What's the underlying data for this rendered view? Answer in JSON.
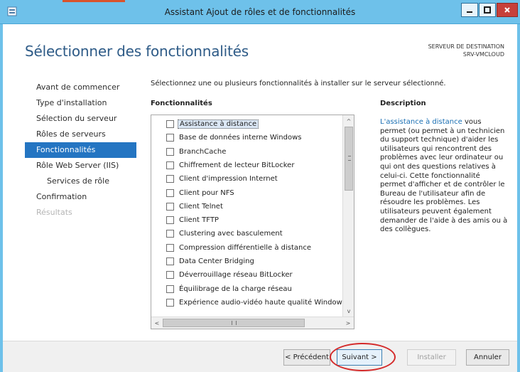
{
  "window": {
    "title": "Assistant Ajout de rôles et de fonctionnalités",
    "min_symbol": "–",
    "max_symbol": "□",
    "close_symbol": "x"
  },
  "header": {
    "page_title": "Sélectionner des fonctionnalités",
    "dest_label": "SERVEUR DE DESTINATION",
    "dest_server": "SRV-VMCLOUD"
  },
  "nav": {
    "items": [
      {
        "label": "Avant de commencer",
        "state": "normal"
      },
      {
        "label": "Type d'installation",
        "state": "normal"
      },
      {
        "label": "Sélection du serveur",
        "state": "normal"
      },
      {
        "label": "Rôles de serveurs",
        "state": "normal"
      },
      {
        "label": "Fonctionnalités",
        "state": "active"
      },
      {
        "label": "Rôle Web Server (IIS)",
        "state": "normal"
      },
      {
        "label": "Services de rôle",
        "state": "sub"
      },
      {
        "label": "Confirmation",
        "state": "normal"
      },
      {
        "label": "Résultats",
        "state": "disabled"
      }
    ]
  },
  "main": {
    "instruction": "Sélectionnez une ou plusieurs fonctionnalités à installer sur le serveur sélectionné.",
    "features_header": "Fonctionnalités",
    "description_header": "Description",
    "features": [
      "Assistance à distance",
      "Base de données interne Windows",
      "BranchCache",
      "Chiffrement de lecteur BitLocker",
      "Client d'impression Internet",
      "Client pour NFS",
      "Client Telnet",
      "Client TFTP",
      "Clustering avec basculement",
      "Compression différentielle à distance",
      "Data Center Bridging",
      "Déverrouillage réseau BitLocker",
      "Équilibrage de la charge réseau",
      "Expérience audio-vidéo haute qualité Windows"
    ],
    "selected_index": 0,
    "scroll_up": "^",
    "scroll_down": "v",
    "scroll_left": "<",
    "scroll_right": ">",
    "description_link": "L'assistance à distance",
    "description_text": " vous permet (ou permet à un technicien du support technique) d'aider les utilisateurs qui rencontrent des problèmes avec leur ordinateur ou qui ont des questions relatives à celui-ci. Cette fonctionnalité permet d'afficher et de contrôler le Bureau de l'utilisateur afin de résoudre les problèmes. Les utilisateurs peuvent également demander de l'aide à des amis ou à des collègues."
  },
  "footer": {
    "prev_label": "< Précédent",
    "next_label": "Suivant >",
    "install_label": "Installer",
    "cancel_label": "Annuler"
  },
  "colors": {
    "titlebar": "#6ec1ea",
    "title_text": "#2e5b87",
    "active_nav": "#2475c2",
    "link": "#1a6fb3",
    "annotation": "#d42a2a"
  }
}
